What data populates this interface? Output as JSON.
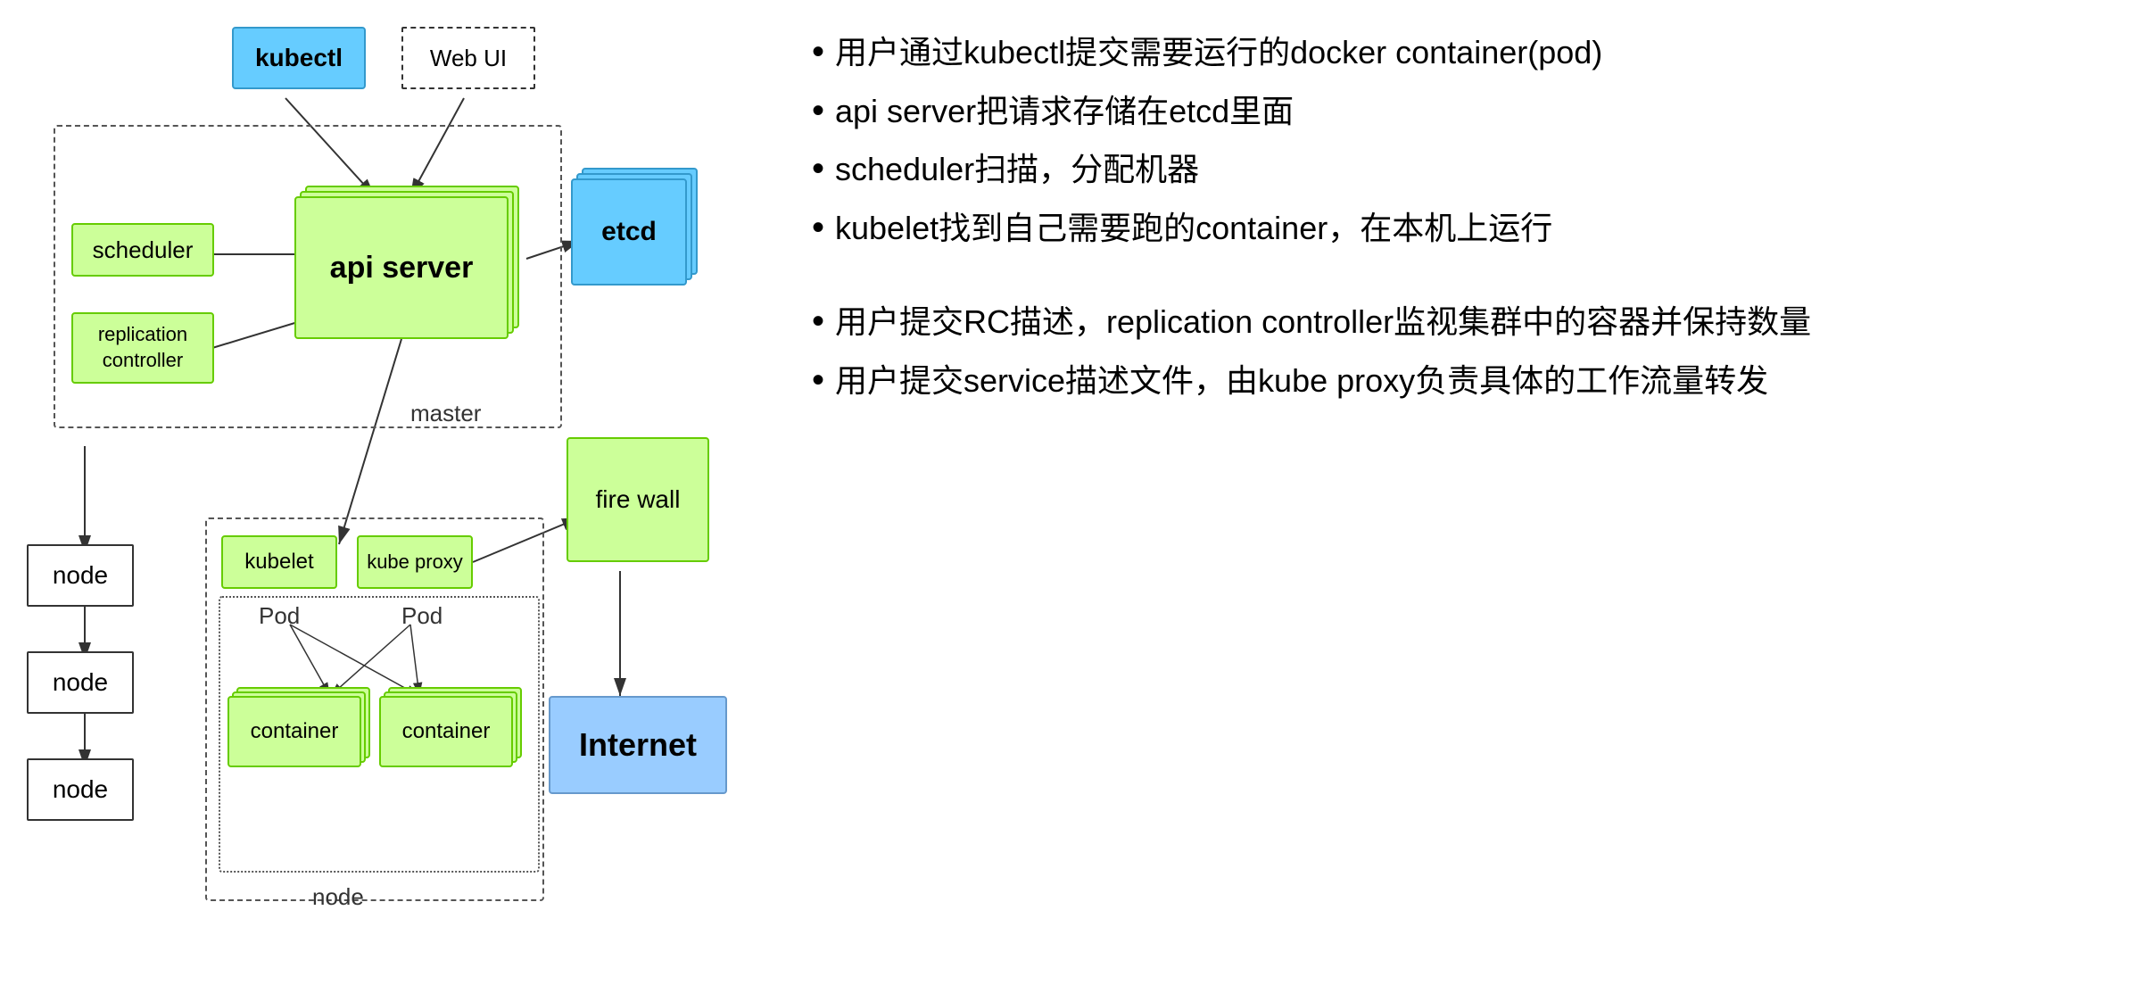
{
  "diagram": {
    "kubectl_label": "kubectl",
    "webui_label": "Web UI",
    "scheduler_label": "scheduler",
    "apiserver_label": "api server",
    "etcd_label": "etcd",
    "replication_controller_label": "replication\ncontroller",
    "master_label": "master",
    "firewall_label": "fire wall",
    "kubelet_label": "kubelet",
    "kubeproxy_label": "kube proxy",
    "pod1_label": "Pod",
    "pod2_label": "Pod",
    "container1_label": "container",
    "container2_label": "container",
    "node_label": "node",
    "node1_label": "node",
    "node2_label": "node",
    "node3_label": "node",
    "internet_label": "Internet"
  },
  "bullets": [
    {
      "text": "用户通过kubectl提交需要运行的docker container(pod)"
    },
    {
      "text": "api server把请求存储在etcd里面"
    },
    {
      "text": "scheduler扫描，分配机器"
    },
    {
      "text": "kubelet找到自己需要跑的container，在本机上运行"
    },
    {
      "text": "用户提交RC描述，replication controller监视集群中的容器并保持数量"
    },
    {
      "text": "用户提交service描述文件，由kube proxy负责具体的工作流量转发"
    }
  ]
}
